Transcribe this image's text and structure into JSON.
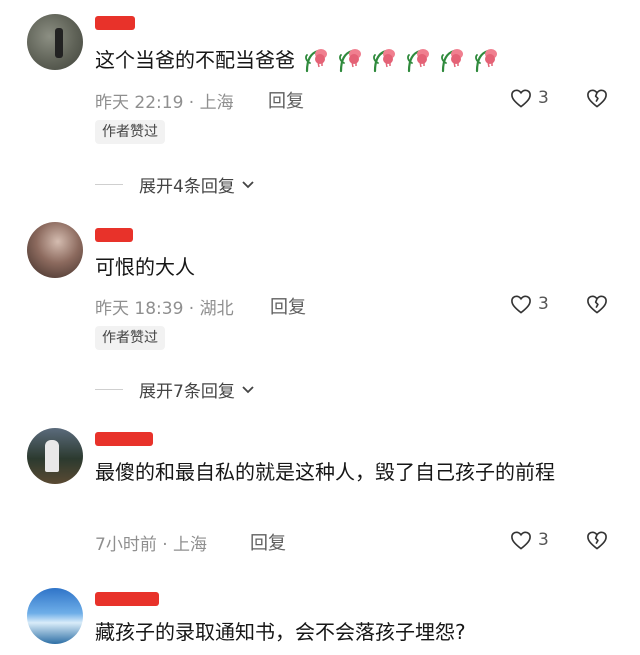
{
  "comments": [
    {
      "text": "这个当爸的不配当爸爸",
      "time": "昨天 22:19",
      "location": "上海",
      "reply_label": "回复",
      "likes": "3",
      "badge": "作者赞过",
      "expand_label": "展开4条回复",
      "emoji_count": 6,
      "emoji_name": "wilted-flower-emoji"
    },
    {
      "text": "可恨的大人",
      "time": "昨天 18:39",
      "location": "湖北",
      "reply_label": "回复",
      "likes": "3",
      "badge": "作者赞过",
      "expand_label": "展开7条回复"
    },
    {
      "text": "最傻的和最自私的就是这种人，毁了自己孩子的前程",
      "time": "7小时前",
      "location": "上海",
      "reply_label": "回复",
      "likes": "3"
    },
    {
      "text": "藏孩子的录取通知书，会不会落孩子埋怨?"
    }
  ],
  "icons": {
    "like": "heart-outline-icon",
    "dislike": "broken-heart-icon",
    "expand": "chevron-down-icon"
  },
  "colors": {
    "redaction": "#e8322a",
    "meta_text": "#8f8f8f",
    "badge_bg": "#f2f2f2"
  }
}
